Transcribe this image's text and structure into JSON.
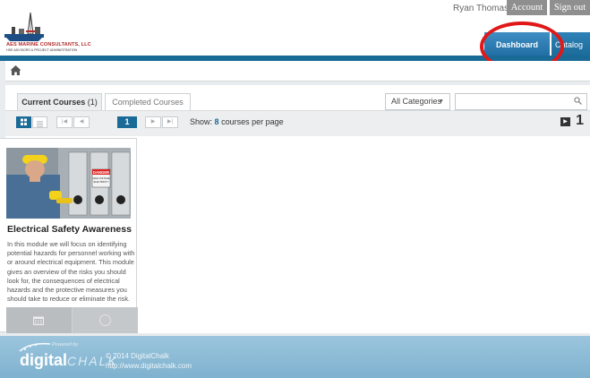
{
  "header": {
    "company_name": "AES MARINE CONSULTANTS, LLC",
    "company_tagline": "HSE ADVISORS & PROJECT ADMINISTRATION",
    "username": "Ryan Thomas",
    "account_label": "Account",
    "signout_label": "Sign out"
  },
  "nav": {
    "tabs": [
      {
        "label": "Dashboard",
        "active": true
      },
      {
        "label": "Catalog",
        "active": false
      }
    ]
  },
  "breadcrumb": {
    "icon": "home-icon"
  },
  "courses": {
    "tabs": [
      {
        "label": "Current Courses",
        "count": "(1)",
        "active": true
      },
      {
        "label": "Completed Courses",
        "active": false
      }
    ],
    "category_select": {
      "value": "All Categories"
    },
    "search": {
      "value": "",
      "icon": "search-icon"
    },
    "toolbar": {
      "current_page": "1",
      "show_prefix": "Show:",
      "per_page": "8",
      "show_suffix": "courses per page",
      "total_count": "1"
    },
    "items": [
      {
        "title": "Electrical Safety Awareness",
        "description": "In this module we will focus on identifying potential hazards for personnel working with or around electrical equipment.  This module gives an overview of the risks you should look for, the consequences of electrical hazards and the protective measures you should take to reduce or eliminate the risk.",
        "image_labels": [
          "DANGER",
          "HIGH VOLTAGE",
          "ELECTRICITY"
        ]
      }
    ]
  },
  "footer": {
    "powered_by": "Powered by",
    "brand_main": "digital",
    "brand_italic": "CHALK",
    "copyright": "© 2014 DigitalChalk",
    "url": "http://www.digitalchalk.com"
  },
  "colors": {
    "primary_blue": "#1a6a98",
    "annotation_red": "#e01818",
    "footer_blue": "#8fbcd6"
  }
}
